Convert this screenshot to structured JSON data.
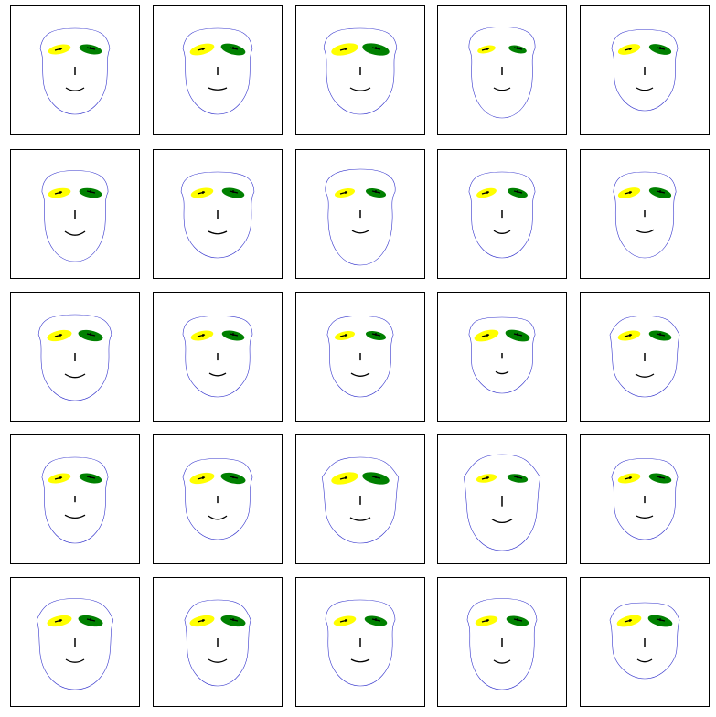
{
  "colors": {
    "face_outline": "#3333cc",
    "left_eye": "#ffff00",
    "right_eye": "#008000",
    "feature_stroke": "#000000",
    "panel_border": "#000000"
  },
  "figure": {
    "rows": 5,
    "cols": 5,
    "faces": [
      {
        "head_width": 1.0,
        "head_height": 1.0,
        "forehead_bulge": 0.6,
        "eye_size": 1.0,
        "eye_tilt": 0.2,
        "nose_length": 1.0,
        "mouth_width": 1.0,
        "mouth_curve": 0.5
      },
      {
        "head_width": 1.0,
        "head_height": 1.0,
        "forehead_bulge": 0.6,
        "eye_size": 1.1,
        "eye_tilt": 0.25,
        "nose_length": 1.0,
        "mouth_width": 1.0,
        "mouth_curve": 0.3
      },
      {
        "head_width": 1.05,
        "head_height": 1.0,
        "forehead_bulge": 0.7,
        "eye_size": 1.2,
        "eye_tilt": 0.2,
        "nose_length": 1.0,
        "mouth_width": 1.1,
        "mouth_curve": 0.5
      },
      {
        "head_width": 0.95,
        "head_height": 1.05,
        "forehead_bulge": 0.9,
        "eye_size": 0.8,
        "eye_tilt": 0.2,
        "nose_length": 1.0,
        "mouth_width": 0.9,
        "mouth_curve": 0.4
      },
      {
        "head_width": 0.95,
        "head_height": 0.95,
        "forehead_bulge": 0.6,
        "eye_size": 1.0,
        "eye_tilt": 0.25,
        "nose_length": 1.0,
        "mouth_width": 0.9,
        "mouth_curve": 0.4
      },
      {
        "head_width": 0.95,
        "head_height": 1.05,
        "forehead_bulge": 0.8,
        "eye_size": 1.0,
        "eye_tilt": 0.15,
        "nose_length": 1.0,
        "mouth_width": 1.1,
        "mouth_curve": 0.7
      },
      {
        "head_width": 1.05,
        "head_height": 1.0,
        "forehead_bulge": 0.8,
        "eye_size": 1.0,
        "eye_tilt": 0.2,
        "nose_length": 1.0,
        "mouth_width": 1.0,
        "mouth_curve": 0.4
      },
      {
        "head_width": 1.0,
        "head_height": 1.1,
        "forehead_bulge": 1.0,
        "eye_size": 0.9,
        "eye_tilt": 0.2,
        "nose_length": 0.9,
        "mouth_width": 0.9,
        "mouth_curve": 0.4
      },
      {
        "head_width": 0.95,
        "head_height": 1.0,
        "forehead_bulge": 0.7,
        "eye_size": 0.9,
        "eye_tilt": 0.25,
        "nose_length": 0.9,
        "mouth_width": 0.9,
        "mouth_curve": 0.5
      },
      {
        "head_width": 0.9,
        "head_height": 1.0,
        "forehead_bulge": 0.7,
        "eye_size": 1.0,
        "eye_tilt": 0.25,
        "nose_length": 0.8,
        "mouth_width": 1.0,
        "mouth_curve": 0.5
      },
      {
        "head_width": 1.05,
        "head_height": 1.0,
        "forehead_bulge": 0.7,
        "eye_size": 1.1,
        "eye_tilt": 0.2,
        "nose_length": 1.0,
        "mouth_width": 1.1,
        "mouth_curve": 0.6
      },
      {
        "head_width": 1.0,
        "head_height": 0.95,
        "forehead_bulge": 0.8,
        "eye_size": 1.0,
        "eye_tilt": 0.2,
        "nose_length": 0.9,
        "mouth_width": 0.9,
        "mouth_curve": 0.4
      },
      {
        "head_width": 0.95,
        "head_height": 0.95,
        "forehead_bulge": 0.6,
        "eye_size": 0.9,
        "eye_tilt": 0.2,
        "nose_length": 0.9,
        "mouth_width": 1.0,
        "mouth_curve": 0.5
      },
      {
        "head_width": 0.95,
        "head_height": 0.9,
        "forehead_bulge": 0.7,
        "eye_size": 1.1,
        "eye_tilt": 0.25,
        "nose_length": 0.7,
        "mouth_width": 0.7,
        "mouth_curve": 0.3
      },
      {
        "head_width": 1.0,
        "head_height": 0.95,
        "forehead_bulge": 0.1,
        "eye_size": 1.0,
        "eye_tilt": 0.2,
        "nose_length": 1.0,
        "mouth_width": 1.0,
        "mouth_curve": 0.5
      },
      {
        "head_width": 0.95,
        "head_height": 1.0,
        "forehead_bulge": 0.6,
        "eye_size": 1.0,
        "eye_tilt": 0.2,
        "nose_length": 0.8,
        "mouth_width": 1.1,
        "mouth_curve": 0.5
      },
      {
        "head_width": 1.0,
        "head_height": 0.95,
        "forehead_bulge": 0.5,
        "eye_size": 1.1,
        "eye_tilt": 0.2,
        "nose_length": 0.9,
        "mouth_width": 1.0,
        "mouth_curve": 0.6
      },
      {
        "head_width": 1.1,
        "head_height": 1.0,
        "forehead_bulge": 0.0,
        "eye_size": 1.2,
        "eye_tilt": 0.2,
        "nose_length": 1.1,
        "mouth_width": 1.1,
        "mouth_curve": 0.5
      },
      {
        "head_width": 1.1,
        "head_height": 1.1,
        "forehead_bulge": 0.0,
        "eye_size": 0.9,
        "eye_tilt": 0.15,
        "nose_length": 1.3,
        "mouth_width": 1.1,
        "mouth_curve": 0.6
      },
      {
        "head_width": 0.95,
        "head_height": 0.95,
        "forehead_bulge": 0.5,
        "eye_size": 1.0,
        "eye_tilt": 0.2,
        "nose_length": 0.9,
        "mouth_width": 0.9,
        "mouth_curve": 0.3
      },
      {
        "head_width": 1.1,
        "head_height": 1.05,
        "forehead_bulge": 0.3,
        "eye_size": 1.1,
        "eye_tilt": 0.2,
        "nose_length": 1.0,
        "mouth_width": 1.0,
        "mouth_curve": 0.5
      },
      {
        "head_width": 0.95,
        "head_height": 1.0,
        "forehead_bulge": 0.3,
        "eye_size": 1.1,
        "eye_tilt": 0.2,
        "nose_length": 1.0,
        "mouth_width": 1.0,
        "mouth_curve": 0.5
      },
      {
        "head_width": 1.0,
        "head_height": 1.0,
        "forehead_bulge": 0.8,
        "eye_size": 1.0,
        "eye_tilt": 0.2,
        "nose_length": 1.0,
        "mouth_width": 1.0,
        "mouth_curve": 0.4
      },
      {
        "head_width": 1.0,
        "head_height": 1.05,
        "forehead_bulge": 0.7,
        "eye_size": 1.0,
        "eye_tilt": 0.2,
        "nose_length": 1.1,
        "mouth_width": 0.9,
        "mouth_curve": 0.5
      },
      {
        "head_width": 1.0,
        "head_height": 0.9,
        "forehead_bulge": 0.3,
        "eye_size": 1.1,
        "eye_tilt": 0.25,
        "nose_length": 1.0,
        "mouth_width": 0.8,
        "mouth_curve": 0.4
      }
    ]
  }
}
